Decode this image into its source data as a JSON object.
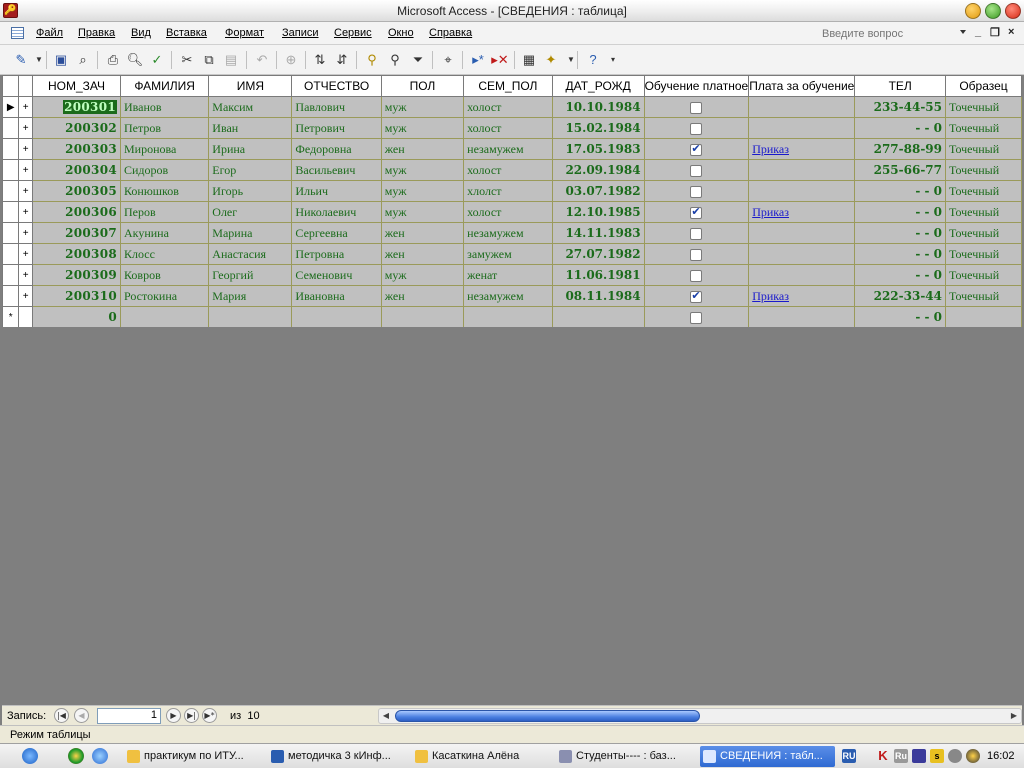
{
  "window": {
    "title": "Microsoft Access - [СВЕДЕНИЯ : таблица]"
  },
  "menu": {
    "items": [
      "Файл",
      "Правка",
      "Вид",
      "Вставка",
      "Формат",
      "Записи",
      "Сервис",
      "Окно",
      "Справка"
    ],
    "ask_placeholder": "Введите вопрос"
  },
  "toolbar": {
    "icons": [
      "view-icon",
      "save-icon",
      "search-file-icon",
      "print-icon",
      "print-preview-icon",
      "spelling-icon",
      "cut-icon",
      "copy-icon",
      "paste-icon",
      "undo-icon",
      "hyperlink-icon",
      "sort-ascending-icon",
      "sort-descending-icon",
      "filter-by-selection-icon",
      "filter-by-form-icon",
      "apply-filter-icon",
      "find-icon",
      "new-record-icon",
      "delete-record-icon",
      "database-window-icon",
      "new-object-icon",
      "help-icon"
    ]
  },
  "table": {
    "columns": [
      "НОМ_ЗАЧ",
      "ФАМИЛИЯ",
      "ИМЯ",
      "ОТЧЕСТВО",
      "ПОЛ",
      "СЕМ_ПОЛ",
      "ДАТ_РОЖД",
      "Обучение платное",
      "Плата за обучение",
      "ТЕЛ",
      "Образец"
    ],
    "rows": [
      {
        "num": "200301",
        "last": "Иванов",
        "first": "Максим",
        "middle": "Павлович",
        "sex": "муж",
        "marital": "холост",
        "dob": "10.10.1984",
        "paid": false,
        "fee": "",
        "tel": "233-44-55",
        "sample": "Точечный"
      },
      {
        "num": "200302",
        "last": "Петров",
        "first": "Иван",
        "middle": "Петрович",
        "sex": "муж",
        "marital": "холост",
        "dob": "15.02.1984",
        "paid": false,
        "fee": "",
        "tel": "- - 0",
        "sample": "Точечный"
      },
      {
        "num": "200303",
        "last": "Миронова",
        "first": "Ирина",
        "middle": "Федоровна",
        "sex": "жен",
        "marital": "незамужем",
        "dob": "17.05.1983",
        "paid": true,
        "fee": "Приказ",
        "tel": "277-88-99",
        "sample": "Точечный"
      },
      {
        "num": "200304",
        "last": "Сидоров",
        "first": "Егор",
        "middle": "Васильевич",
        "sex": "муж",
        "marital": "холост",
        "dob": "22.09.1984",
        "paid": false,
        "fee": "",
        "tel": "255-66-77",
        "sample": "Точечный"
      },
      {
        "num": "200305",
        "last": "Конюшков",
        "first": "Игорь",
        "middle": "Ильич",
        "sex": "муж",
        "marital": "хлолст",
        "dob": "03.07.1982",
        "paid": false,
        "fee": "",
        "tel": "- - 0",
        "sample": "Точечный"
      },
      {
        "num": "200306",
        "last": "Перов",
        "first": "Олег",
        "middle": "Николаевич",
        "sex": "муж",
        "marital": "холост",
        "dob": "12.10.1985",
        "paid": true,
        "fee": "Приказ",
        "tel": "- - 0",
        "sample": "Точечный"
      },
      {
        "num": "200307",
        "last": "Акунина",
        "first": "Марина",
        "middle": "Сергеевна",
        "sex": "жен",
        "marital": "незамужем",
        "dob": "14.11.1983",
        "paid": false,
        "fee": "",
        "tel": "- - 0",
        "sample": "Точечный"
      },
      {
        "num": "200308",
        "last": "Клосс",
        "first": "Анастасия",
        "middle": "Петровна",
        "sex": "жен",
        "marital": "замужем",
        "dob": "27.07.1982",
        "paid": false,
        "fee": "",
        "tel": "- - 0",
        "sample": "Точечный"
      },
      {
        "num": "200309",
        "last": "Ковров",
        "first": "Георгий",
        "middle": "Семенович",
        "sex": "муж",
        "marital": "женат",
        "dob": "11.06.1981",
        "paid": false,
        "fee": "",
        "tel": "- - 0",
        "sample": "Точечный"
      },
      {
        "num": "200310",
        "last": "Ростокина",
        "first": "Мария",
        "middle": "Ивановна",
        "sex": "жен",
        "marital": "незамужем",
        "dob": "08.11.1984",
        "paid": true,
        "fee": "Приказ",
        "tel": "222-33-44",
        "sample": "Точечный"
      }
    ],
    "new_row": {
      "num": "0",
      "tel": "- - 0"
    },
    "current_row_marker": "▶",
    "new_row_marker": "*"
  },
  "navigation": {
    "record_label": "Запись:",
    "current": "1",
    "of_label": "из",
    "total": "10"
  },
  "status": {
    "text": "Режим таблицы"
  },
  "taskbar": {
    "tasks": [
      {
        "label": "практикум по ИТУ...",
        "icon": "folder-icon",
        "active": false
      },
      {
        "label": "методичка 3 кИнф...",
        "icon": "word-icon",
        "active": false
      },
      {
        "label": "Касаткина Алёна",
        "icon": "folder-icon",
        "active": false
      },
      {
        "label": "Студенты---- : баз...",
        "icon": "access-db-icon",
        "active": false
      },
      {
        "label": "СВЕДЕНИЯ : табл...",
        "icon": "table-icon",
        "active": true
      }
    ],
    "language": "RU",
    "clock": "16:02"
  },
  "colors": {
    "data_green": "#148814",
    "link_blue": "#1a1acc",
    "mdi_background": "#7f7f7f",
    "active_task": "#2f6ad2"
  }
}
